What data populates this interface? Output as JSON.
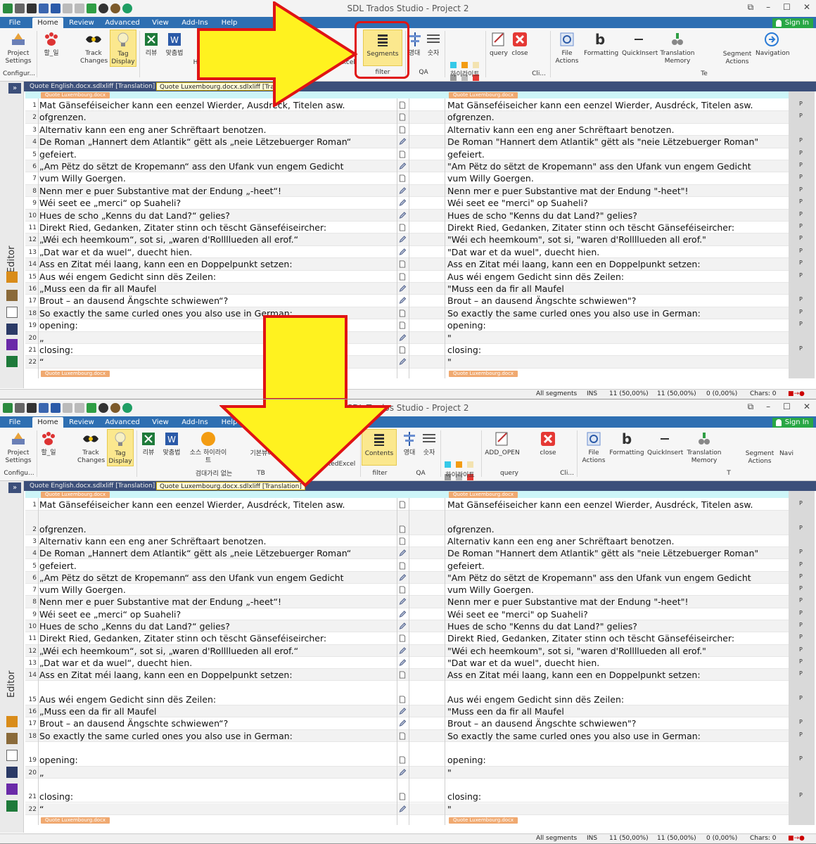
{
  "window": {
    "title": "SDL Trados Studio - Project 2"
  },
  "menu_tabs": [
    "File",
    "Home",
    "Review",
    "Advanced",
    "View",
    "Add-Ins",
    "Help"
  ],
  "signin": "Sign In",
  "ribbon_top": {
    "project_settings": "Project Settings",
    "configu": "Configur...",
    "korean_do": "할_일",
    "track_changes": "Track Changes",
    "tag_display": "Tag Display",
    "review": "리뷰",
    "spellcheck": "맞춤법",
    "h_cut": "H",
    "excel_cut": "Excel",
    "segments": "Segments",
    "filter": "filter",
    "qa1": "영대",
    "qa2": "숫자",
    "qa": "QA",
    "highlight": "하이라이트",
    "query": "query",
    "close": "close",
    "cli": "Cli...",
    "file_actions": "File Actions",
    "formatting": "Formatting",
    "quickinsert": "QuickInsert",
    "translation_memory": "Translation Memory",
    "te": "Te",
    "segment_actions": "Segment Actions",
    "navigation": "Navigation"
  },
  "ribbon_bottom": {
    "project_settings": "Project Settings",
    "configu": "Configu...",
    "korean_do": "할_일",
    "track_changes": "Track Changes",
    "tag_display": "Tag Display",
    "review": "리뷰",
    "spellcheck": "맞춤법",
    "source_highlight": "소스 하이라이트",
    "bracket_none": "검대가리 없는",
    "basic": "기본뷰어",
    "tb": "TB",
    "excel_cut": "tedExcel",
    "contents": "Contents",
    "filter": "filter",
    "qa1": "영대",
    "qa2": "숫자",
    "qa": "QA",
    "highlight": "하이라이트",
    "add_open": "ADD_OPEN",
    "query": "query",
    "close": "close",
    "cli": "Cli...",
    "file_actions": "File Actions",
    "formatting": "Formatting",
    "quickinsert": "QuickInsert",
    "translation_memory": "Translation Memory",
    "t": "T",
    "segment_actions": "Segment Actions",
    "navi": "Navi"
  },
  "doc_tabs_top": [
    "Quote English.docx.sdlxliff [Translation]",
    "Quote Luxembourg.docx.sdlxliff [Tran"
  ],
  "doc_tabs_bottom": [
    "Quote English.docx.sdlxliff [Translation]",
    "Quote Luxembourg.docx.sdlxliff [Translation]"
  ],
  "editor_label": "Editor",
  "expand": "»",
  "file_tag": "Quote Luxembourg.docx",
  "segments": [
    {
      "n": "1",
      "src": "Mat Gänseféiseicher kann een eenzel Wierder, Ausdréck, Titelen asw.",
      "tgt": "Mat Gänseféiseicher kann een eenzel Wierder, Ausdréck, Titelen asw.",
      "st": "doc",
      "p": "P"
    },
    {
      "n": "2",
      "src": "ofgrenzen.",
      "tgt": "ofgrenzen.",
      "st": "doc",
      "p": "P"
    },
    {
      "n": "3",
      "src": "Alternativ kann een eng aner Schrëftaart benotzen.",
      "tgt": "Alternativ kann een eng aner Schrëftaart benotzen.",
      "st": "doc",
      "p": ""
    },
    {
      "n": "4",
      "src": "De Roman „Hannert dem Atlantik“ gëtt als „neie Lëtzebuerger Roman“",
      "tgt": "De Roman \"Hannert dem Atlantik\" gëtt als \"neie Lëtzebuerger Roman\"",
      "st": "pen",
      "p": "P"
    },
    {
      "n": "5",
      "src": "gefeiert.",
      "tgt": "gefeiert.",
      "st": "doc",
      "p": "P"
    },
    {
      "n": "6",
      "src": "„Am Pëtz do sëtzt de Kropemann“ ass den Ufank vun engem Gedicht",
      "tgt": "\"Am Pëtz do sëtzt de Kropemann\" ass den Ufank vun engem Gedicht",
      "st": "pen",
      "p": "P"
    },
    {
      "n": "7",
      "src": "vum Willy Goergen.",
      "tgt": "vum Willy Goergen.",
      "st": "doc",
      "p": "P"
    },
    {
      "n": "8",
      "src": "Nenn mer e puer Substantive mat der Endung „-heet“!",
      "tgt": "Nenn mer e puer Substantive mat der Endung \"-heet\"!",
      "st": "pen",
      "p": "P"
    },
    {
      "n": "9",
      "src": "Wéi seet ee „merci“ op Suaheli?",
      "tgt": "Wéi seet ee \"merci\" op Suaheli?",
      "st": "pen",
      "p": "P"
    },
    {
      "n": "10",
      "src": "Hues de scho „Kenns du dat Land?“ gelies?",
      "tgt": "Hues de scho \"Kenns du dat Land?\" gelies?",
      "st": "pen",
      "p": "P"
    },
    {
      "n": "11",
      "src": "Direkt Ried, Gedanken, Zitater stinn och tëscht Gänseféiseircher:",
      "tgt": "Direkt Ried, Gedanken, Zitater stinn och tëscht Gänseféiseircher:",
      "st": "doc",
      "p": "P"
    },
    {
      "n": "12",
      "src": "„Wéi ech heemkoum“, sot si, „waren d'Rollllueden all erof.“",
      "tgt": "\"Wéi ech heemkoum\", sot si, \"waren d'Rollllueden all erof.\"",
      "st": "pen",
      "p": "P"
    },
    {
      "n": "13",
      "src": "„Dat war et da wuel“, duecht hien.",
      "tgt": "\"Dat war et da wuel\", duecht hien.",
      "st": "pen",
      "p": "P"
    },
    {
      "n": "14",
      "src": "Ass en Zitat méi laang, kann een en Doppelpunkt setzen:",
      "tgt": "Ass en Zitat méi laang, kann een en Doppelpunkt setzen:",
      "st": "doc",
      "p": "P"
    },
    {
      "n": "15",
      "src": "Aus wéi engem Gedicht sinn dës Zeilen:",
      "tgt": "Aus wéi engem Gedicht sinn dës Zeilen:",
      "st": "doc",
      "p": "P"
    },
    {
      "n": "16",
      "src": "„Muss een da fir all Maufel",
      "tgt": "\"Muss een da fir all Maufel",
      "st": "pen",
      "p": ""
    },
    {
      "n": "17",
      "src": "Brout – an dausend Ängschte schwiewen“?",
      "tgt": "Brout – an dausend Ängschte schwiewen\"?",
      "st": "pen",
      "p": "P"
    },
    {
      "n": "18",
      "src": "So exactly the same curled ones you also use in German:",
      "tgt": "So exactly the same curled ones you also use in German:",
      "st": "doc",
      "p": "P"
    },
    {
      "n": "19",
      "src": "opening:",
      "tgt": "opening:",
      "st": "doc",
      "p": "P"
    },
    {
      "n": "20",
      "src": "„",
      "tgt": "\"",
      "st": "pen",
      "p": ""
    },
    {
      "n": "21",
      "src": "closing:",
      "tgt": "closing:",
      "st": "doc",
      "p": "P"
    },
    {
      "n": "22",
      "src": "“",
      "tgt": "\"",
      "st": "pen",
      "p": ""
    }
  ],
  "status": {
    "filter": "All segments",
    "ins": "INS",
    "docstat": "11 (50,00%)",
    "penstat": "11 (50,00%)",
    "checkstat": "0 (0,00%)",
    "chars": "Chars: 0"
  },
  "colors": {
    "ribbon_blue": "#2e6fb2",
    "arrow_yellow": "#fff21f",
    "arrow_red": "#e01414",
    "highlight": "#fbe88e"
  }
}
